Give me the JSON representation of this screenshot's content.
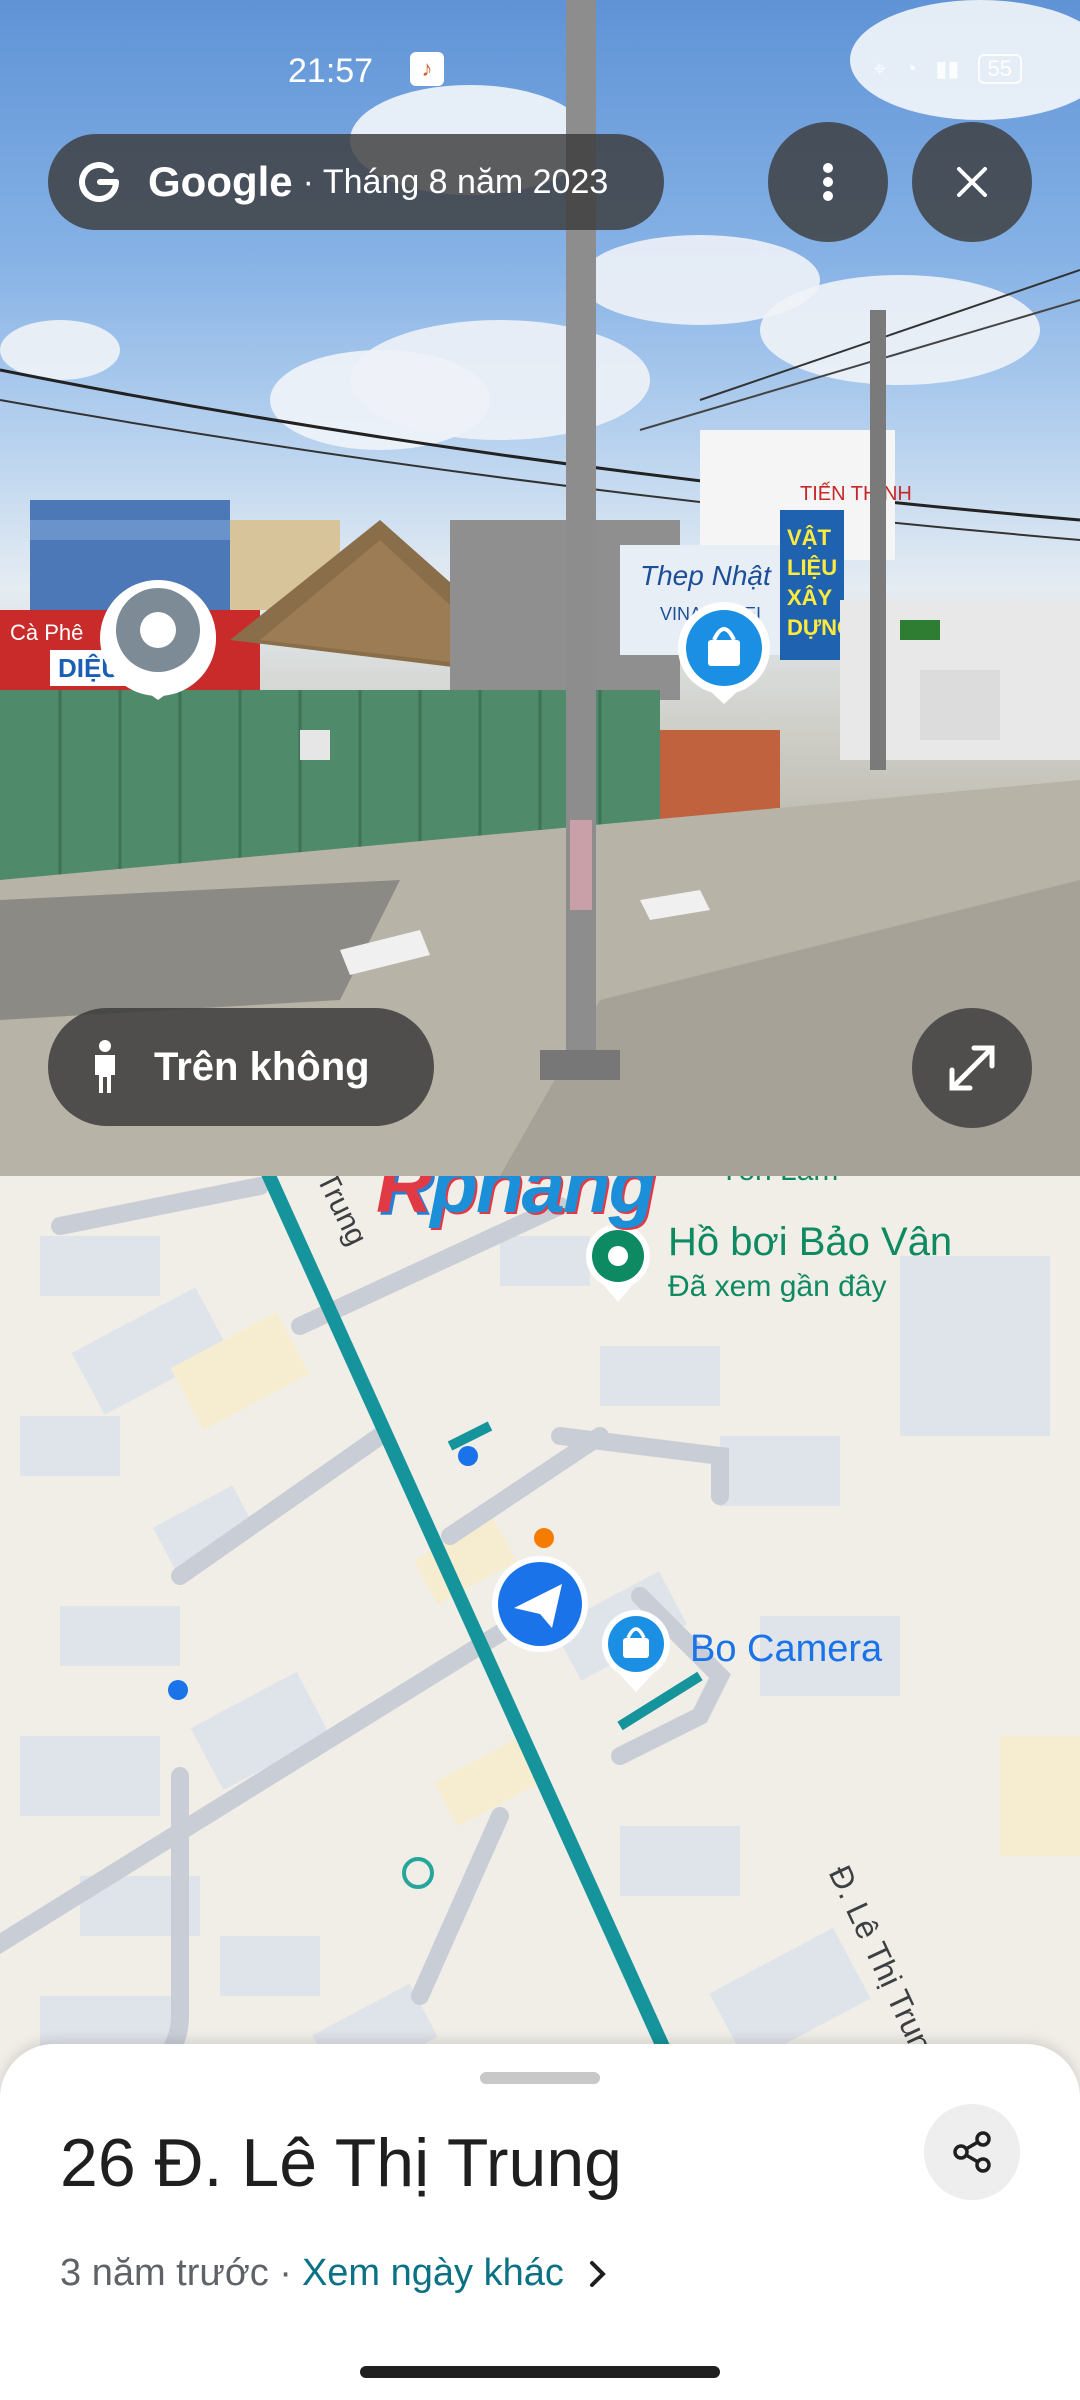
{
  "status_bar": {
    "time": "21:57",
    "app_icon": "tiktok-icon",
    "battery": "55"
  },
  "header": {
    "brand": "Google",
    "date": " · Tháng 8 năm 2023"
  },
  "street_view": {
    "signs": {
      "steel": "Thep Nhật",
      "steel_sub": "VINA KYOEI",
      "materials": [
        "VẬT",
        "LIỆU",
        "XÂY",
        "DỰNG"
      ],
      "shop_top": "TIẾN THỊNH"
    },
    "view_toggle": {
      "label": "Trên không",
      "icon": "person-icon"
    }
  },
  "map": {
    "watermark": {
      "first": "R",
      "rest": "phang"
    },
    "street_top": "Trung",
    "street_top_pre": "ị",
    "street_bottom": "Đ. Lê Thị Trung",
    "partial_label": "Tôn Lâm",
    "poi": {
      "name": "Hồ bơi Bảo Vân",
      "subtitle": "Đã xem gần đây"
    },
    "shop": {
      "name": "Bo Camera"
    }
  },
  "sheet": {
    "title": "26 Đ. Lê Thị Trung",
    "age": "3 năm trước ·",
    "link": "Xem ngày khác"
  },
  "colors": {
    "route": "#1a9aa0",
    "poi_green": "#0e8a63",
    "blue": "#1a73e8"
  }
}
